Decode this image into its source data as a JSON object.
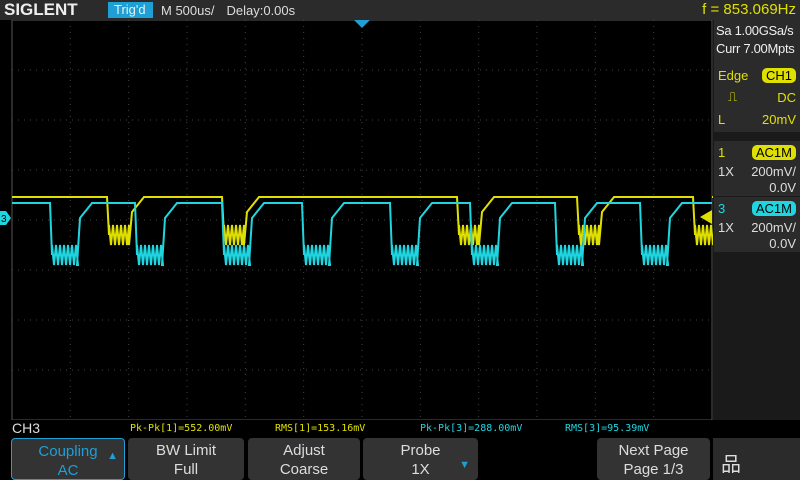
{
  "header": {
    "logo": "SIGLENT",
    "trigger_status": "Trig'd",
    "timebase": "M 500us/",
    "delay": "Delay:0.00s",
    "frequency": "f = 853.069Hz"
  },
  "acquisition": {
    "sample_rate": "Sa 1.00GSa/s",
    "memory": "Curr 7.00Mpts"
  },
  "trigger": {
    "type": "Edge",
    "source": "CH1",
    "slope_icon": "rising-edge-icon",
    "coupling": "DC",
    "level_label": "L",
    "level": "20mV"
  },
  "channels": [
    {
      "num": "1",
      "coupling": "AC1M",
      "probe": "1X",
      "scale": "200mV/",
      "offset": "0.0V",
      "color": "#e0e000"
    },
    {
      "num": "3",
      "coupling": "AC1M",
      "probe": "1X",
      "scale": "200mV/",
      "offset": "0.0V",
      "color": "#1fd6e0"
    }
  ],
  "menu_title": "CH3",
  "measurements": [
    {
      "text": "Pk-Pk[1]=552.00mV",
      "color": "#e0e000"
    },
    {
      "text": "RMS[1]=153.16mV",
      "color": "#e0e000"
    },
    {
      "text": "Pk-Pk[3]=288.00mV",
      "color": "#1fd6e0"
    },
    {
      "text": "RMS[3]=95.39mV",
      "color": "#1fd6e0"
    }
  ],
  "softkeys": [
    {
      "label": "Coupling",
      "value": "AC"
    },
    {
      "label": "BW Limit",
      "value": "Full"
    },
    {
      "label": "Adjust",
      "value": "Coarse"
    },
    {
      "label": "Probe",
      "value": "1X"
    },
    {
      "label": "Next Page",
      "value": "Page 1/3"
    }
  ],
  "ch3_marker": "3"
}
